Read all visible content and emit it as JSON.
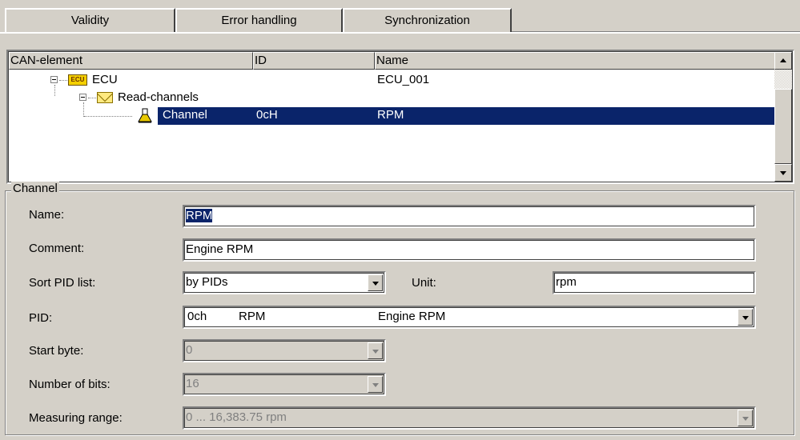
{
  "tabs": [
    {
      "label": "Validity"
    },
    {
      "label": "Error handling"
    },
    {
      "label": "Synchronization"
    }
  ],
  "tree": {
    "columns": [
      "CAN-element",
      "ID",
      "Name"
    ],
    "rows": [
      {
        "element": "ECU",
        "id": "",
        "name": "ECU_001",
        "icon": "ecu-icon"
      },
      {
        "element": "Read-channels",
        "id": "",
        "name": "",
        "icon": "envelope-icon"
      },
      {
        "element": "Channel",
        "id": "0cH",
        "name": "RPM",
        "icon": "flask-icon",
        "selected": true
      }
    ],
    "ecu_badge": "ECU"
  },
  "group": {
    "title": "Channel",
    "name_label": "Name:",
    "name_value": "RPM",
    "comment_label": "Comment:",
    "comment_value": "Engine RPM",
    "sort_label": "Sort PID list:",
    "sort_value": "by PIDs",
    "unit_label": "Unit:",
    "unit_value": "rpm",
    "pid_label": "PID:",
    "pid_code": "0ch",
    "pid_name": "RPM",
    "pid_desc": "Engine RPM",
    "start_label": "Start byte:",
    "start_value": "0",
    "bits_label": "Number of bits:",
    "bits_value": "16",
    "range_label": "Measuring range:",
    "range_value": "0 ... 16,383.75 rpm"
  },
  "colors": {
    "selection": "#0a246a",
    "face": "#d4d0c8"
  }
}
